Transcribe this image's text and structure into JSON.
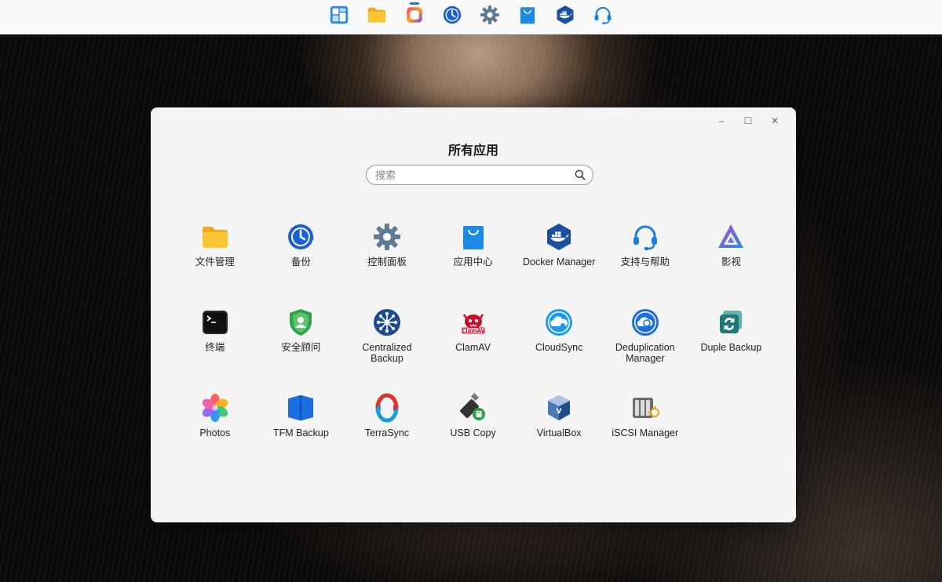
{
  "window": {
    "title": "所有应用",
    "search_placeholder": "搜索",
    "minimize_glyph": "–",
    "maximize_glyph": "☐",
    "close_glyph": "✕"
  },
  "taskbar": [
    {
      "name": "tiles-icon",
      "running": false
    },
    {
      "name": "folder-icon",
      "running": false
    },
    {
      "name": "media-app-icon",
      "running": true
    },
    {
      "name": "backup-icon",
      "running": false
    },
    {
      "name": "gear-icon",
      "running": false
    },
    {
      "name": "shopping-bag-icon",
      "running": false
    },
    {
      "name": "docker-icon",
      "running": false
    },
    {
      "name": "headset-icon",
      "running": false
    }
  ],
  "apps": [
    [
      {
        "label": "文件管理",
        "icon": "folder-icon"
      },
      {
        "label": "备份",
        "icon": "backup-icon"
      },
      {
        "label": "控制面板",
        "icon": "gear-icon"
      },
      {
        "label": "应用中心",
        "icon": "shopping-bag-icon"
      },
      {
        "label": "Docker Manager",
        "icon": "docker-icon"
      },
      {
        "label": "支持与帮助",
        "icon": "headset-icon"
      },
      {
        "label": "影视",
        "icon": "jellyfin-icon"
      }
    ],
    [
      {
        "label": "终端",
        "icon": "terminal-icon"
      },
      {
        "label": "安全顾问",
        "icon": "shield-icon"
      },
      {
        "label": "Centralized Backup",
        "icon": "network-hub-icon"
      },
      {
        "label": "ClamAV",
        "icon": "clamav-icon"
      },
      {
        "label": "CloudSync",
        "icon": "cloud-icon"
      },
      {
        "label": "Deduplication Manager",
        "icon": "dedup-icon"
      },
      {
        "label": "Duple Backup",
        "icon": "sync-icon"
      }
    ],
    [
      {
        "label": "Photos",
        "icon": "flower-icon"
      },
      {
        "label": "TFM Backup",
        "icon": "book-icon"
      },
      {
        "label": "TerraSync",
        "icon": "terrasync-icon"
      },
      {
        "label": "USB Copy",
        "icon": "usb-icon"
      },
      {
        "label": "VirtualBox",
        "icon": "virtualbox-icon"
      },
      {
        "label": "iSCSI Manager",
        "icon": "iscsi-icon"
      }
    ]
  ],
  "colors": {
    "accent_blue": "#1f6fe5",
    "folder_yellow": "#fbc532",
    "docker_navy": "#1b4fa0",
    "window_bg": "#f4f4f4"
  }
}
